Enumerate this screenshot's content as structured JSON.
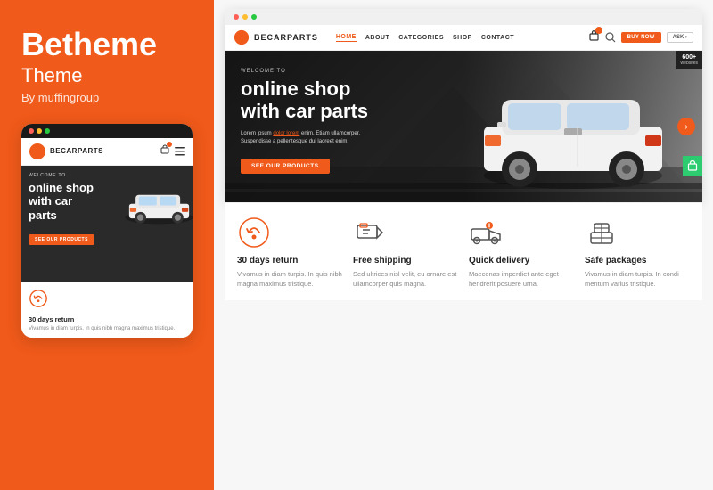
{
  "left": {
    "brand": "Betheme",
    "theme_label": "Theme",
    "by_label": "By muffingroup",
    "mobile": {
      "dots": [
        "red",
        "yellow",
        "green"
      ],
      "logo_text": "BECARPARTS",
      "hero_welcome": "WELCOME TO",
      "hero_title": "online shop with car parts",
      "cta_label": "SEE OUR PRODUCTS",
      "feature_title": "30 days return",
      "feature_desc": "Vivamus in diam turpis. In quis nibh magna maximus tristique."
    }
  },
  "right": {
    "browser_dots": [
      "red",
      "yellow",
      "green"
    ],
    "nav": {
      "logo": "BECARPARTS",
      "links": [
        "HOME",
        "ABOUT",
        "CATEGORIES",
        "SHOP",
        "CONTACT"
      ],
      "active": "HOME",
      "buy_now": "BUY NOW",
      "ask": "ASK ›"
    },
    "hero": {
      "welcome": "WELCOME TO",
      "title_line1": "online shop",
      "title_line2": "with car parts",
      "desc_line1": "Lorem ipsum ",
      "desc_link": "dolor lorem",
      "desc_line2": " enim. Etiam ullamcorper.",
      "desc_line3": "Suspendisse a pellentesque dui laoreet enim.",
      "cta": "SEE OUR PRODUCTS",
      "badge": "600+",
      "badge_sub": "websites"
    },
    "features": [
      {
        "icon": "return",
        "title": "30 days return",
        "desc": "Vivamus in diam turpis. In quis nibh magna maximus tristique."
      },
      {
        "icon": "shipping",
        "title": "Free shipping",
        "desc": "Sed ultrices nisl velit, eu ornare est ullamcorper quis magna."
      },
      {
        "icon": "delivery",
        "title": "Quick delivery",
        "desc": "Maecenas imperdiet ante eget hendrerit posuere urna."
      },
      {
        "icon": "packages",
        "title": "Safe packages",
        "desc": "Vivamus in diam turpis. In condi mentum varius tristique."
      }
    ]
  }
}
